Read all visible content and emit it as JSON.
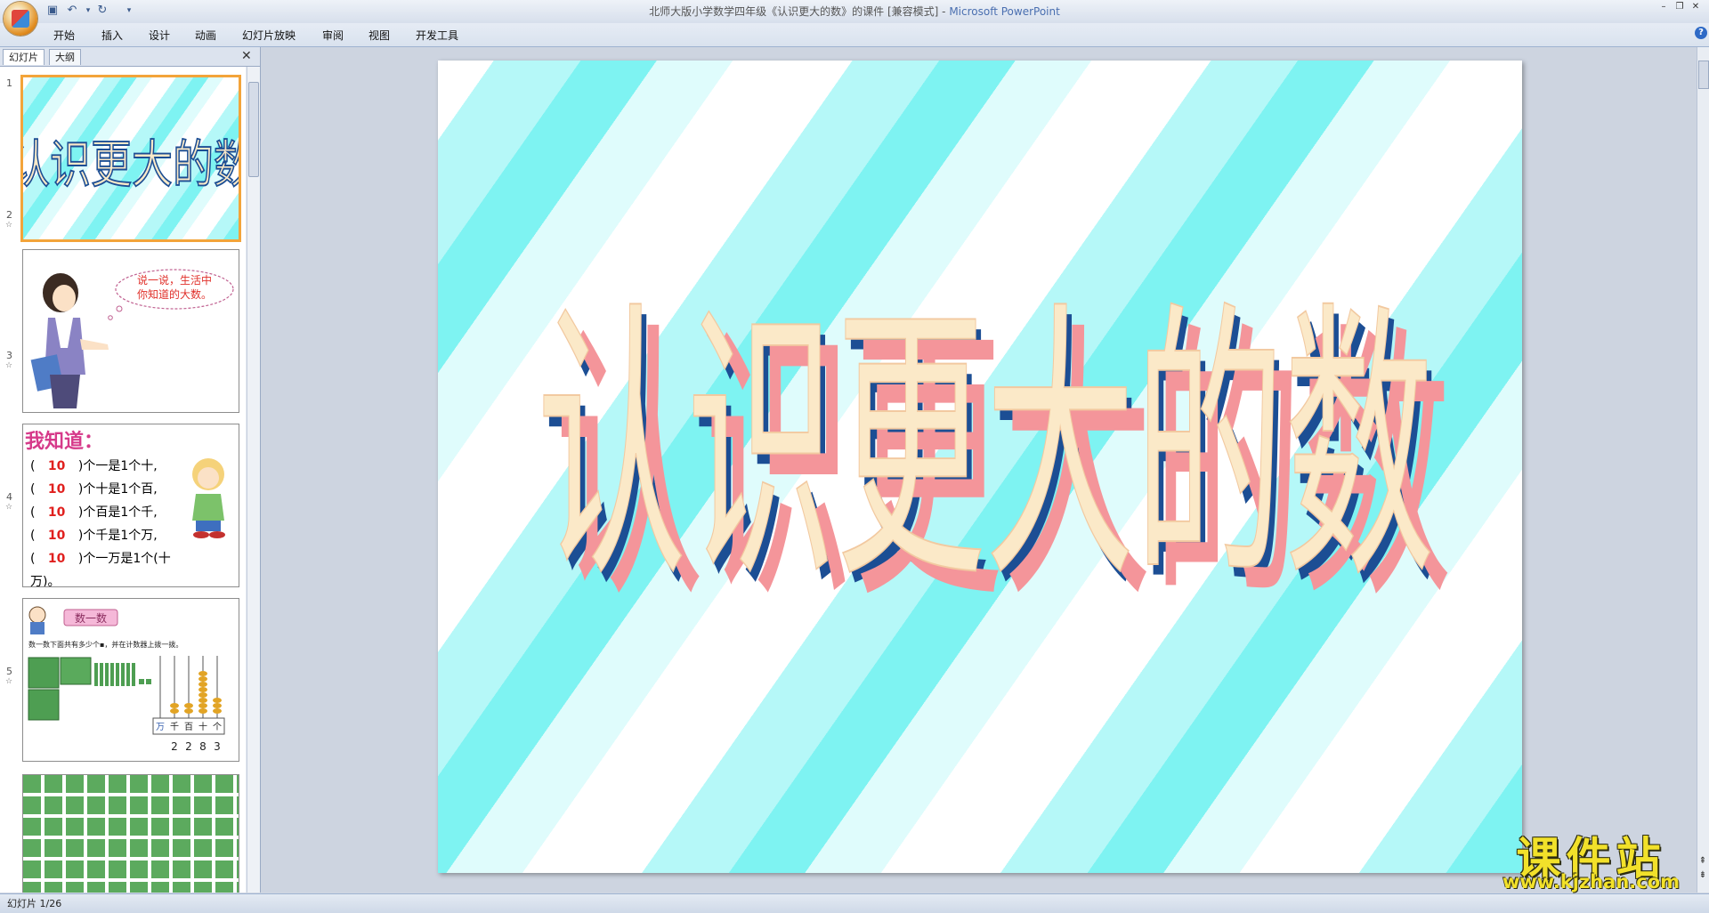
{
  "window": {
    "title": "北师大版小学数学四年级《认识更大的数》的课件 [兼容模式] - ",
    "app_name": "Microsoft PowerPoint"
  },
  "quick_access": {
    "save_icon": "save-icon",
    "undo_icon": "undo-icon",
    "redo_icon": "redo-icon",
    "customize_icon": "dropdown-arrow-icon"
  },
  "ribbon": {
    "tabs": [
      "开始",
      "插入",
      "设计",
      "动画",
      "幻灯片放映",
      "审阅",
      "视图",
      "开发工具"
    ]
  },
  "left_pane": {
    "tab_slides": "幻灯片",
    "tab_outline": "大纲",
    "close_icon": "close-icon"
  },
  "thumbnails": [
    {
      "number": "1",
      "title": "认识更大的数"
    },
    {
      "number": "2",
      "bubble_line1": "说一说，生活中",
      "bubble_line2": "你知道的大数。"
    },
    {
      "number": "3",
      "heading": "我知道：",
      "rows": [
        {
          "open": "(",
          "value": "10",
          "text": ")个一是1个十,"
        },
        {
          "open": "(",
          "value": "10",
          "text": ")个十是1个百,"
        },
        {
          "open": "(",
          "value": "10",
          "text": ")个百是1个千,"
        },
        {
          "open": "(",
          "value": "10",
          "text": ")个千是1个万,"
        },
        {
          "open": "(",
          "value": "10",
          "text": ")个一万是1个(十万)。"
        }
      ]
    },
    {
      "number": "4",
      "badge": "数一数",
      "instruction": "数一数下面共有多少个▪，并在计数器上拨一拨。",
      "abacus_labels": [
        "万",
        "千",
        "百",
        "十",
        "个"
      ],
      "digits": [
        "2",
        "2",
        "8",
        "3"
      ]
    },
    {
      "number": "5"
    }
  ],
  "slide": {
    "title": "认识更大的数",
    "colors": {
      "stripe_cyan": "#7ef3f2",
      "text_face": "#fbe9c8",
      "text_shadow_navy": "#1c4e94",
      "text_shadow_pink": "#f4959a"
    }
  },
  "status": {
    "text": "幻灯片 1/26"
  },
  "watermark": {
    "text_cn": "课件站",
    "url": "www.kjzhan.com"
  }
}
